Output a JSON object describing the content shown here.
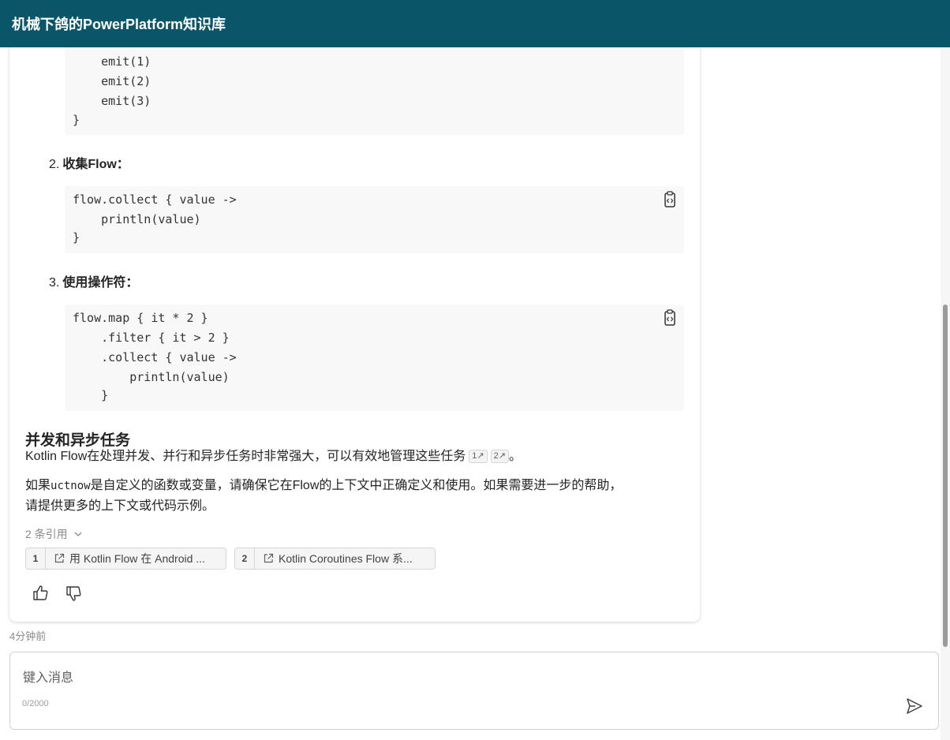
{
  "header": {
    "title": "机械下鸽的PowerPlatform知识库"
  },
  "code_blocks": [
    {
      "lines": [
        "    emit(1)",
        "    emit(2)",
        "    emit(3)",
        "}"
      ]
    },
    {
      "lines": [
        "flow.collect { value ->",
        "    println(value)",
        "}"
      ]
    },
    {
      "lines": [
        "flow.map { it * 2 }",
        "    .filter { it > 2 }",
        "    .collect { value ->",
        "        println(value)",
        "    }"
      ]
    }
  ],
  "list_items": [
    {
      "number": "2.",
      "label": "收集Flow："
    },
    {
      "number": "3.",
      "label": "使用操作符："
    }
  ],
  "section": {
    "title": "并发和异步任务",
    "paragraph": "Kotlin Flow在处理并发、并行和异步任务时非常强大，可以有效地管理这些任务",
    "cite1": "1",
    "cite2": "2",
    "period": "。"
  },
  "paragraph2": {
    "prefix": "如果",
    "code": "uctnow",
    "line1_rest": "是自定义的函数或变量，请确保它在Flow的上下文中正确定义和使用。如果需要进一步的帮助，",
    "line2": "请提供更多的上下文或代码示例。"
  },
  "references": {
    "toggle_label": "2 条引用",
    "items": [
      {
        "index": "1",
        "text": "用 Kotlin Flow 在 Android ..."
      },
      {
        "index": "2",
        "text": "Kotlin Coroutines Flow 系..."
      }
    ]
  },
  "timestamp": "4分钟前",
  "input": {
    "placeholder": "键入消息",
    "char_count": "0/2000"
  },
  "colors": {
    "header_bg": "#0b5569",
    "code_bg": "#f8f8f8"
  },
  "icons": [
    "copy-code-icon",
    "external-link-icon",
    "thumbs-up-icon",
    "thumbs-down-icon",
    "send-icon",
    "chevron-down-icon"
  ]
}
